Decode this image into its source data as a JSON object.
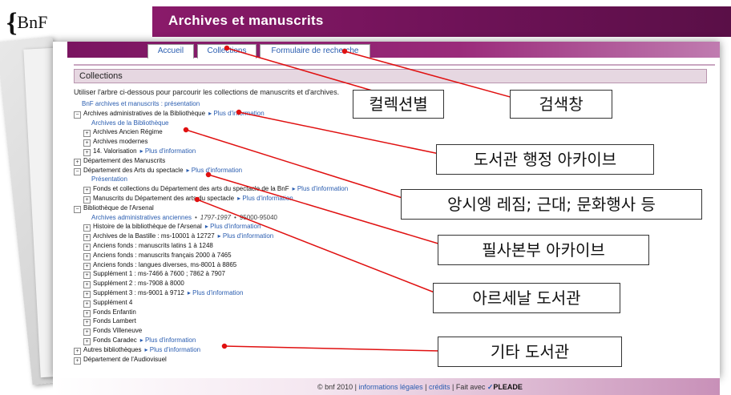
{
  "logo": {
    "brace": "{",
    "text": "BnF"
  },
  "header": {
    "title": "Archives et manuscrits"
  },
  "tabs": [
    {
      "label": "Accueil"
    },
    {
      "label": "Collections"
    },
    {
      "label": "Formulaire de recherche"
    }
  ],
  "section": {
    "title": "Collections"
  },
  "intro": "Utiliser l'arbre ci-dessous pour parcourir les collections de manuscrits et d'archives.",
  "more_label": "Plus d'information",
  "tree": {
    "r1": "BnF archives et manuscrits : présentation",
    "r2": "Archives administratives de la Bibliothèque",
    "r3": "Archives de la Bibliothèque",
    "r4": "Archives Ancien Régime",
    "r5": "Archives modernes",
    "r6": "14. Valorisation",
    "r7": "Département des Manuscrits",
    "r8": "Département des Arts du spectacle",
    "r9": "Présentation",
    "r10": "Fonds et collections du Département des arts du spectacle de la BnF",
    "r11": "Manuscrits du Département des arts du spectacle",
    "r12": "Bibliothèque de l'Arsenal",
    "r13": "Archives administratives anciennes",
    "r13_dates": "1797-1997",
    "r13_cote": "95000-95040",
    "r14": "Histoire de la bibliothèque de l'Arsenal",
    "r15": "Archives de la Bastille : ms-10001 à 12727",
    "r16": "Anciens fonds : manuscrits latins 1 à 1248",
    "r17": "Anciens fonds : manuscrits français 2000 à 7465",
    "r18": "Anciens fonds : langues diverses, ms-8001 à 8865",
    "r19": "Supplément 1 : ms-7466 à 7600 ; 7862 à 7907",
    "r20": "Supplément 2 : ms-7908 à 8000",
    "r21": "Supplément 3 : ms-9001 à 9712",
    "r22": "Supplément 4",
    "r23": "Fonds Enfantin",
    "r24": "Fonds Lambert",
    "r25": "Fonds Villeneuve",
    "r26": "Fonds Caradec",
    "r27": "Autres bibliothèques",
    "r28": "Département de l'Audiovisuel"
  },
  "footer": {
    "copyright": "© bnf 2010 |",
    "legal": "informations légales",
    "sep": "|",
    "credits": "crédits",
    "made_with": "| Fait avec",
    "pleade": "PLEADE"
  },
  "callouts": {
    "c1": "컬렉션별",
    "c2": "검색창",
    "c3": "도서관 행정 아카이브",
    "c4": "앙시엥 레짐; 근대; 문화행사 등",
    "c5": "필사본부 아카이브",
    "c6": "아르세날 도서관",
    "c7": "기타 도서관"
  },
  "colors": {
    "header": "#7a1460",
    "link": "#2a5db0",
    "arrow": "#e01010"
  }
}
